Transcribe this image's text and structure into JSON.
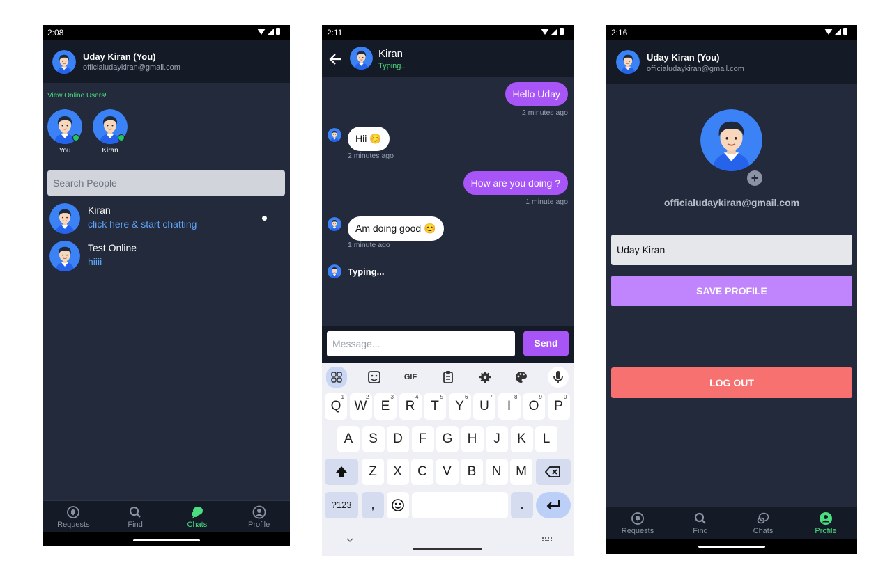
{
  "screen1": {
    "status_time": "2:08",
    "header": {
      "name": "Uday Kiran (You)",
      "email": "officialudaykiran@gmail.com"
    },
    "online_label": "View Online Users!",
    "online_users": [
      {
        "name": "You"
      },
      {
        "name": "Kiran"
      }
    ],
    "search_placeholder": "Search People",
    "chats": [
      {
        "name": "Kiran",
        "message": "click here & start chatting",
        "unread": true
      },
      {
        "name": "Test Online",
        "message": "hiiii",
        "unread": false
      }
    ],
    "nav": {
      "items": [
        "Requests",
        "Find",
        "Chats",
        "Profile"
      ],
      "active": "Chats"
    }
  },
  "screen2": {
    "status_time": "2:11",
    "header": {
      "name": "Kiran",
      "status": "Typing.."
    },
    "messages": [
      {
        "from": "me",
        "text": "Hello Uday",
        "time": "2 minutes ago"
      },
      {
        "from": "them",
        "text": "Hii ☺️",
        "time": "2 minutes ago"
      },
      {
        "from": "me",
        "text": "How are you doing ?",
        "time": "1 minute ago"
      },
      {
        "from": "them",
        "text": "Am doing good 😊",
        "time": "1 minute ago"
      }
    ],
    "typing_indicator": "Typing...",
    "input_placeholder": "Message...",
    "send_label": "Send",
    "keyboard": {
      "toolbar": [
        "apps-icon",
        "sticker-icon",
        "GIF",
        "clipboard-icon",
        "settings-icon",
        "palette-icon",
        "mic-icon"
      ],
      "row1": [
        {
          "k": "Q",
          "s": "1"
        },
        {
          "k": "W",
          "s": "2"
        },
        {
          "k": "E",
          "s": "3"
        },
        {
          "k": "R",
          "s": "4"
        },
        {
          "k": "T",
          "s": "5"
        },
        {
          "k": "Y",
          "s": "6"
        },
        {
          "k": "U",
          "s": "7"
        },
        {
          "k": "I",
          "s": "8"
        },
        {
          "k": "O",
          "s": "9"
        },
        {
          "k": "P",
          "s": "0"
        }
      ],
      "row2": [
        "A",
        "S",
        "D",
        "F",
        "G",
        "H",
        "J",
        "K",
        "L"
      ],
      "row3": [
        "Z",
        "X",
        "C",
        "V",
        "B",
        "N",
        "M"
      ],
      "symbols_label": "?123",
      "comma": ",",
      "period": "."
    }
  },
  "screen3": {
    "status_time": "2:16",
    "header": {
      "name": "Uday Kiran (You)",
      "email": "officialudaykiran@gmail.com"
    },
    "profile_email": "officialudaykiran@gmail.com",
    "name_value": "Uday Kiran",
    "save_label": "SAVE PROFILE",
    "logout_label": "LOG OUT",
    "nav": {
      "items": [
        "Requests",
        "Find",
        "Chats",
        "Profile"
      ],
      "active": "Profile"
    }
  },
  "colors": {
    "accent": "#a855f7",
    "online": "#22c55e",
    "logout": "#f87171",
    "link": "#60a5fa",
    "background": "#222a3b"
  }
}
